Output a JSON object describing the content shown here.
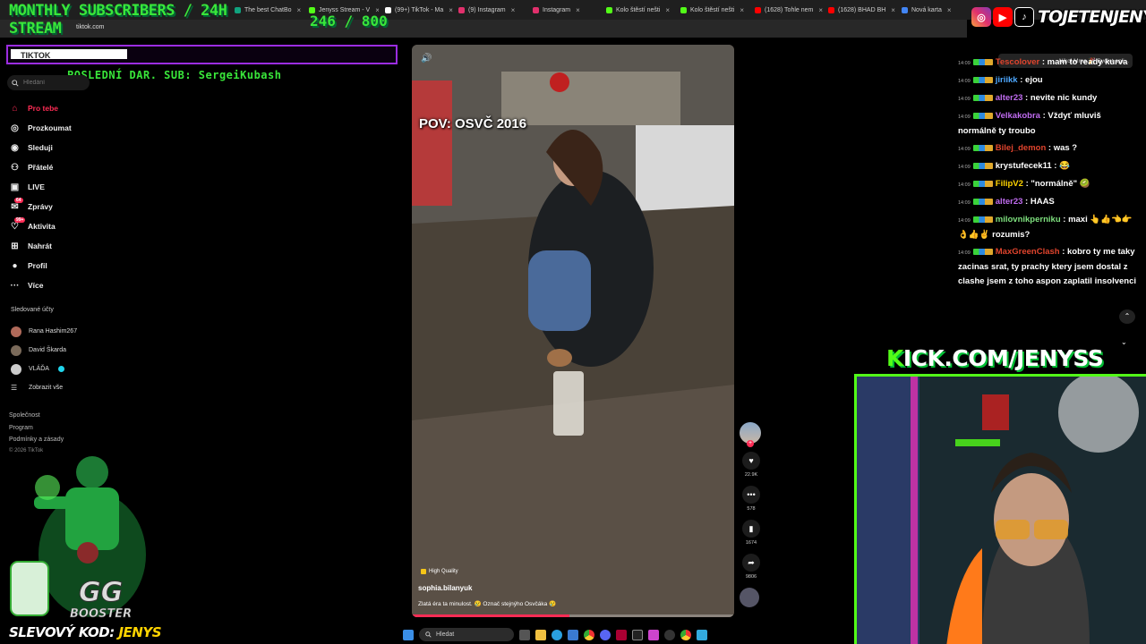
{
  "browser": {
    "tabs": [
      {
        "label": "The best ChatBo",
        "color": "#10a37f"
      },
      {
        "label": "Jenyss Stream - V",
        "color": "#53fc18"
      },
      {
        "label": "(99+) TikTok - Ma",
        "color": "#ffffff"
      },
      {
        "label": "(9) Instagram",
        "color": "#e1306c"
      },
      {
        "label": "Instagram",
        "color": "#e1306c"
      },
      {
        "label": "Kolo štěstí nešti",
        "color": "#53fc18"
      },
      {
        "label": "Kolo štěstí nešti",
        "color": "#53fc18"
      },
      {
        "label": "(1628) Tohle nem",
        "color": "#ff0000"
      },
      {
        "label": "(1628) BHAD BH",
        "color": "#ff0000"
      },
      {
        "label": "Nová karta",
        "color": "#4285f4"
      }
    ],
    "address": "tiktok.com"
  },
  "overlay": {
    "goal_title": "MONTHLY SUBSCRIBERS / 24H STREAM",
    "goal_count": "246 / 800",
    "donor_label": "TIKTOK",
    "last_sub": "POSLEDNÍ DAR. SUB: SergeiKubash",
    "promo_label": "SLEVOVÝ KOD:",
    "promo_code": "JENYS",
    "kick_k": "K",
    "kick_rest": "ICK.COM/JENYSS",
    "social_name": "TOJETENJENYS"
  },
  "tiktok": {
    "search_placeholder": "Hledání",
    "nav": [
      {
        "label": "Pro tebe",
        "icon": "home-icon",
        "active": true
      },
      {
        "label": "Prozkoumat",
        "icon": "compass-icon"
      },
      {
        "label": "Sleduji",
        "icon": "following-icon"
      },
      {
        "label": "Přátelé",
        "icon": "friends-icon"
      },
      {
        "label": "LIVE",
        "icon": "live-icon"
      },
      {
        "label": "Zprávy",
        "icon": "messages-icon",
        "badge": "64"
      },
      {
        "label": "Aktivita",
        "icon": "activity-icon",
        "badge": "99+"
      },
      {
        "label": "Nahrát",
        "icon": "upload-icon"
      },
      {
        "label": "Profil",
        "icon": "profile-icon"
      },
      {
        "label": "Více",
        "icon": "more-icon"
      }
    ],
    "followed_title": "Sledované účty",
    "followed": [
      {
        "name": "Rana Hashim267",
        "color": "#b06a5a"
      },
      {
        "name": "David Škarda",
        "color": "#7a6a5a"
      },
      {
        "name": "VLÁĎA",
        "color": "#cccccc",
        "verified": true
      }
    ],
    "show_all": "Zobrazit vše",
    "footer": [
      "Společnost",
      "Program",
      "Podmínky a zásady",
      "© 2026 TikTok"
    ]
  },
  "video": {
    "caption": "POV: OSVČ 2016",
    "quality": "High Quality",
    "author": "sophia.bilanyuk",
    "description": "Zlatá éra ta minulost. 😢 Označ stejnýho Osvčáka 😢",
    "progress": 0.49,
    "likes": "22.9K",
    "comments": "578",
    "saves": "1674",
    "shares": "9806"
  },
  "chat": {
    "header": "Nikol Mrna 🎉 Bydlet apli...",
    "messages": [
      {
        "time": "14:09",
        "user": "Tescolover",
        "color": "#e0442d",
        "text": ": mam to ready kurva"
      },
      {
        "time": "14:09",
        "user": "jiriikk",
        "color": "#4ea8ff",
        "text": ": ejou"
      },
      {
        "time": "14:09",
        "user": "alter23",
        "color": "#c06cf0",
        "text": ": nevite nic kundy"
      },
      {
        "time": "14:09",
        "user": "Velkakobra",
        "color": "#c06cf0",
        "text": ": Vždyť mluviš normálně ty troubo"
      },
      {
        "time": "14:09",
        "user": "Bilej_demon",
        "color": "#e0442d",
        "text": ": was ?"
      },
      {
        "time": "14:09",
        "user": "krystufecek11",
        "color": "#ffffff",
        "text": ": 😂"
      },
      {
        "time": "14:09",
        "user": "FilipV2",
        "color": "#ffd400",
        "text": ": \"normálně\" 🥝"
      },
      {
        "time": "14:09",
        "user": "alter23",
        "color": "#c06cf0",
        "text": ": HAAS"
      },
      {
        "time": "14:09",
        "user": "milovnikperniku",
        "color": "#7ee07e",
        "text": ": maxi 👆👍👈👉👌👍✌ rozumis?"
      },
      {
        "time": "14:09",
        "user": "MaxGreenClash",
        "color": "#e0442d",
        "text": ": kobro ty me taky zacinas srat, ty prachy ktery jsem dostal z clashe jsem z toho aspon zaplatil insolvenci"
      }
    ]
  },
  "taskbar": {
    "search": "Hledat"
  },
  "colors": {
    "accent": "#fe2c55",
    "kick_green": "#53fc18",
    "overlay_green": "#39e63a",
    "frame_purple": "#9b2de0"
  }
}
